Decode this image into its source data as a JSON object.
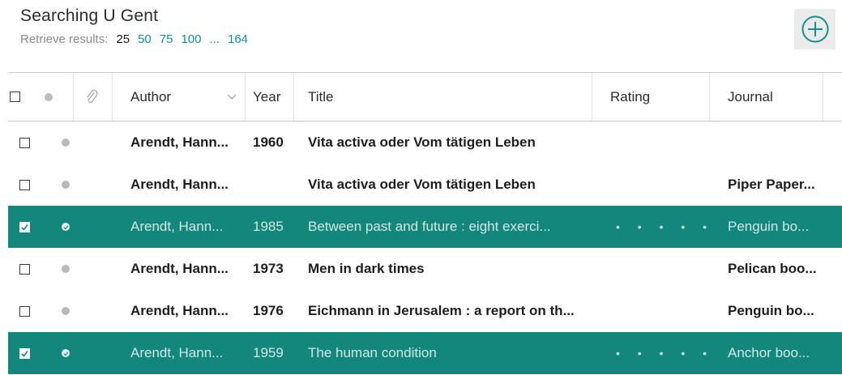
{
  "header": {
    "title": "Searching U Gent",
    "retrieve_label": "Retrieve results:",
    "retrieve_options": [
      "25",
      "50",
      "75",
      "100",
      "...",
      "164"
    ]
  },
  "add_button": {
    "icon": "plus-circle-icon"
  },
  "columns": {
    "select_all": "checkbox",
    "read_status": "dot",
    "attachment": "paperclip-icon",
    "author": "Author",
    "year": "Year",
    "title": "Title",
    "rating": "Rating",
    "journal": "Journal"
  },
  "rows": [
    {
      "checked": false,
      "author": "Arendt, Hann...",
      "year": "1960",
      "title": "Vita activa oder Vom tätigen Leben",
      "rating": "",
      "journal": ""
    },
    {
      "checked": false,
      "author": "Arendt, Hann...",
      "year": "",
      "title": "Vita activa oder Vom tätigen Leben",
      "rating": "",
      "journal": "Piper Paper..."
    },
    {
      "checked": true,
      "author": "Arendt, Hann...",
      "year": "1985",
      "title": "Between past and future : eight exerci...",
      "rating": "• • • • •",
      "journal": "Penguin bo..."
    },
    {
      "checked": false,
      "author": "Arendt, Hann...",
      "year": "1973",
      "title": "Men in dark times",
      "rating": "",
      "journal": "Pelican boo..."
    },
    {
      "checked": false,
      "author": "Arendt, Hann...",
      "year": "1976",
      "title": "Eichmann in Jerusalem : a report on th...",
      "rating": "",
      "journal": "Penguin bo..."
    },
    {
      "checked": true,
      "author": "Arendt, Hann...",
      "year": "1959",
      "title": "The human condition",
      "rating": "• • • • •",
      "journal": "Anchor boo..."
    }
  ],
  "colors": {
    "accent": "#15908a",
    "selected_row": "#14877d"
  }
}
